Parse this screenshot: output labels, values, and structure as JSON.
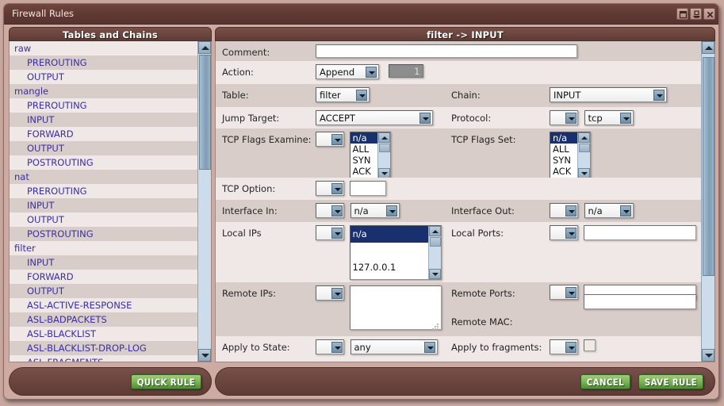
{
  "window": {
    "title": "Firewall Rules",
    "buttons": [
      {
        "name": "restore-button",
        "icon": "restore-icon"
      },
      {
        "name": "shade-button",
        "icon": "shade-icon"
      },
      {
        "name": "close-button",
        "icon": "close-icon"
      }
    ]
  },
  "sidebar": {
    "header": "Tables and Chains",
    "items": [
      {
        "label": "raw",
        "level": 0
      },
      {
        "label": "PREROUTING",
        "level": 1
      },
      {
        "label": "OUTPUT",
        "level": 1
      },
      {
        "label": "mangle",
        "level": 0
      },
      {
        "label": "PREROUTING",
        "level": 1
      },
      {
        "label": "INPUT",
        "level": 1
      },
      {
        "label": "FORWARD",
        "level": 1
      },
      {
        "label": "OUTPUT",
        "level": 1
      },
      {
        "label": "POSTROUTING",
        "level": 1
      },
      {
        "label": "nat",
        "level": 0
      },
      {
        "label": "PREROUTING",
        "level": 1
      },
      {
        "label": "INPUT",
        "level": 1
      },
      {
        "label": "OUTPUT",
        "level": 1
      },
      {
        "label": "POSTROUTING",
        "level": 1
      },
      {
        "label": "filter",
        "level": 0
      },
      {
        "label": "INPUT",
        "level": 1
      },
      {
        "label": "FORWARD",
        "level": 1
      },
      {
        "label": "OUTPUT",
        "level": 1
      },
      {
        "label": "ASL-ACTIVE-RESPONSE",
        "level": 1
      },
      {
        "label": "ASL-BADPACKETS",
        "level": 1
      },
      {
        "label": "ASL-BLACKLIST",
        "level": 1
      },
      {
        "label": "ASL-BLACKLIST-DROP-LOG",
        "level": 1
      },
      {
        "label": "ASL-FRAGMENTS",
        "level": 1
      }
    ]
  },
  "form": {
    "header": "filter -> INPUT",
    "comment": {
      "label": "Comment:",
      "value": "",
      "placeholder": ""
    },
    "action": {
      "label": "Action:",
      "value": "Append",
      "position_value": "1"
    },
    "table": {
      "label": "Table:",
      "value": "filter"
    },
    "chain": {
      "label": "Chain:",
      "value": "INPUT"
    },
    "jump_target": {
      "label": "Jump Target:",
      "value": "ACCEPT"
    },
    "protocol": {
      "label": "Protocol:",
      "negate": "",
      "value": "tcp"
    },
    "tcp_flags_examine": {
      "label": "TCP Flags Examine:",
      "negate": "",
      "options": [
        "n/a",
        "ALL",
        "SYN",
        "ACK"
      ],
      "selected": "n/a"
    },
    "tcp_flags_set": {
      "label": "TCP Flags Set:",
      "options": [
        "n/a",
        "ALL",
        "SYN",
        "ACK"
      ],
      "selected": "n/a"
    },
    "tcp_option": {
      "label": "TCP Option:",
      "negate": "",
      "value": ""
    },
    "interface_in": {
      "label": "Interface In:",
      "negate": "",
      "value": "n/a"
    },
    "interface_out": {
      "label": "Interface Out:",
      "negate": "",
      "value": "n/a"
    },
    "local_ips": {
      "label": "Local IPs",
      "negate": "",
      "options": [
        "n/a",
        "",
        "127.0.0.1"
      ],
      "selected": "n/a"
    },
    "local_ports": {
      "label": "Local Ports:",
      "negate": "",
      "value": ""
    },
    "remote_ips": {
      "label": "Remote IPs:",
      "negate": "",
      "value": ""
    },
    "remote_ports": {
      "label": "Remote Ports:",
      "negate": "",
      "value": ""
    },
    "remote_mac": {
      "label": "Remote MAC:",
      "value": ""
    },
    "apply_to_state": {
      "label": "Apply to State:",
      "negate": "",
      "value": "any"
    },
    "apply_to_fragments": {
      "label": "Apply to fragments:",
      "negate": "",
      "checked": false
    }
  },
  "footer": {
    "quick_rule": "QUICK RULE",
    "cancel": "CANCEL",
    "save_rule": "SAVE RULE"
  },
  "colors": {
    "titlebar": "#603832",
    "panel_header": "#6a443d",
    "accent_green": "#7fb857",
    "link_blue": "#3b2fa0",
    "select_blue": "#18316e",
    "band": "#d9cdca",
    "plain": "#efe8e6"
  }
}
